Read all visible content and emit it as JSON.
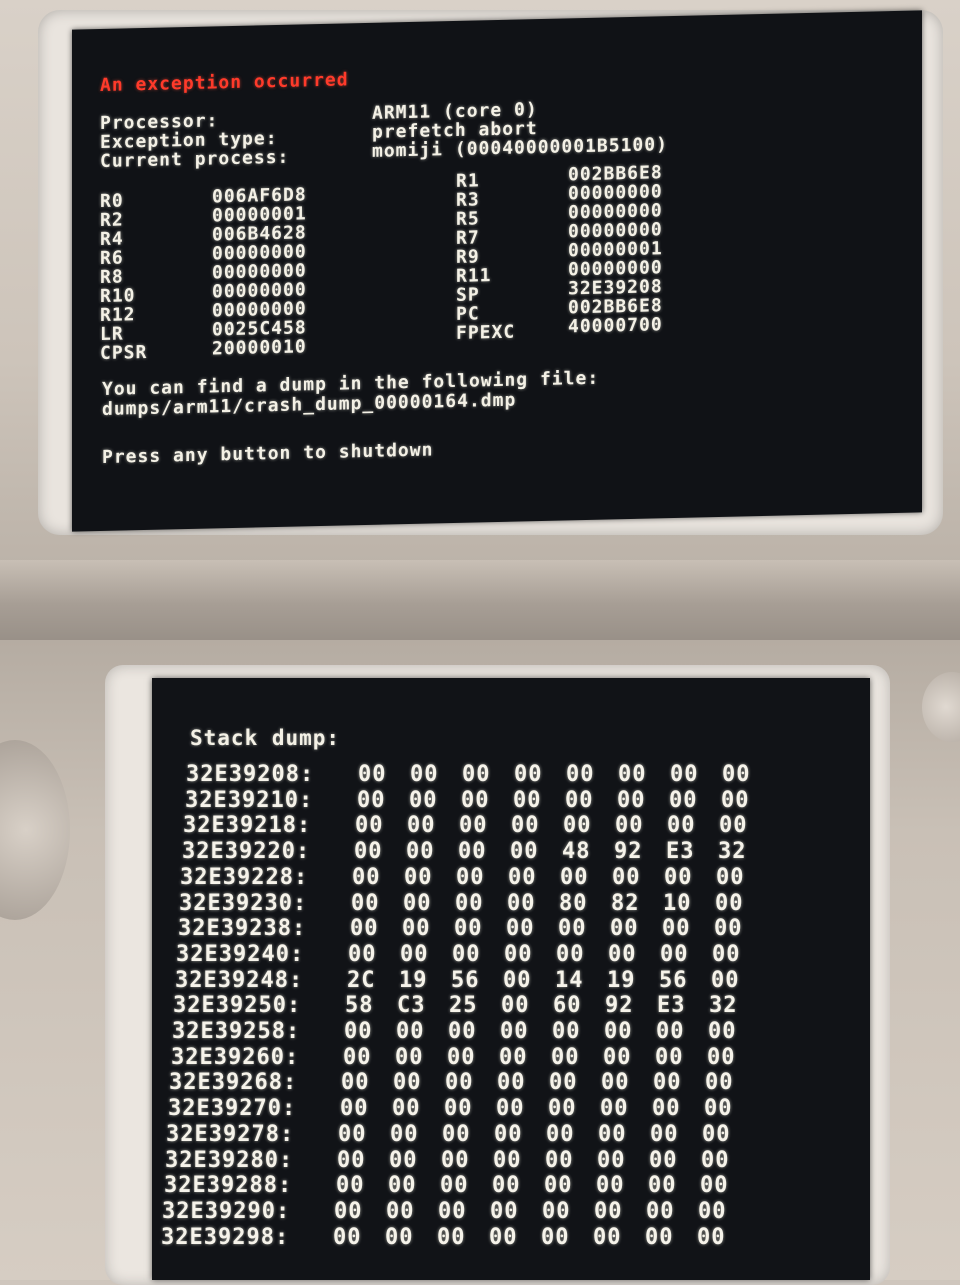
{
  "top_screen": {
    "title": "An exception occurred",
    "info": [
      {
        "label": "Processor:",
        "value": "ARM11 (core 0)"
      },
      {
        "label": "Exception type:",
        "value": "prefetch abort"
      },
      {
        "label": "Current process:",
        "value": "momiji (00040000001B5100)"
      }
    ],
    "registers_left": [
      {
        "name": "R0",
        "value": "006AF6D8"
      },
      {
        "name": "R2",
        "value": "00000001"
      },
      {
        "name": "R4",
        "value": "006B4628"
      },
      {
        "name": "R6",
        "value": "00000000"
      },
      {
        "name": "R8",
        "value": "00000000"
      },
      {
        "name": "R10",
        "value": "00000000"
      },
      {
        "name": "R12",
        "value": "00000000"
      },
      {
        "name": "LR",
        "value": "0025C458"
      },
      {
        "name": "CPSR",
        "value": "20000010"
      }
    ],
    "registers_right": [
      {
        "name": "R1",
        "value": "002BB6E8"
      },
      {
        "name": "R3",
        "value": "00000000"
      },
      {
        "name": "R5",
        "value": "00000000"
      },
      {
        "name": "R7",
        "value": "00000000"
      },
      {
        "name": "R9",
        "value": "00000001"
      },
      {
        "name": "R11",
        "value": "00000000"
      },
      {
        "name": "SP",
        "value": "32E39208"
      },
      {
        "name": "PC",
        "value": "002BB6E8"
      },
      {
        "name": "FPEXC",
        "value": "40000700"
      }
    ],
    "dump_line1": "You can find a dump in the following file:",
    "dump_line2": "dumps/arm11/crash_dump_00000164.dmp",
    "prompt": "Press any button to shutdown"
  },
  "bottom_screen": {
    "title": "Stack dump:",
    "rows": [
      {
        "addr": "32E39208:",
        "bytes": [
          "00",
          "00",
          "00",
          "00",
          "00",
          "00",
          "00",
          "00"
        ]
      },
      {
        "addr": "32E39210:",
        "bytes": [
          "00",
          "00",
          "00",
          "00",
          "00",
          "00",
          "00",
          "00"
        ]
      },
      {
        "addr": "32E39218:",
        "bytes": [
          "00",
          "00",
          "00",
          "00",
          "00",
          "00",
          "00",
          "00"
        ]
      },
      {
        "addr": "32E39220:",
        "bytes": [
          "00",
          "00",
          "00",
          "00",
          "48",
          "92",
          "E3",
          "32"
        ]
      },
      {
        "addr": "32E39228:",
        "bytes": [
          "00",
          "00",
          "00",
          "00",
          "00",
          "00",
          "00",
          "00"
        ]
      },
      {
        "addr": "32E39230:",
        "bytes": [
          "00",
          "00",
          "00",
          "00",
          "80",
          "82",
          "10",
          "00"
        ]
      },
      {
        "addr": "32E39238:",
        "bytes": [
          "00",
          "00",
          "00",
          "00",
          "00",
          "00",
          "00",
          "00"
        ]
      },
      {
        "addr": "32E39240:",
        "bytes": [
          "00",
          "00",
          "00",
          "00",
          "00",
          "00",
          "00",
          "00"
        ]
      },
      {
        "addr": "32E39248:",
        "bytes": [
          "2C",
          "19",
          "56",
          "00",
          "14",
          "19",
          "56",
          "00"
        ]
      },
      {
        "addr": "32E39250:",
        "bytes": [
          "58",
          "C3",
          "25",
          "00",
          "60",
          "92",
          "E3",
          "32"
        ]
      },
      {
        "addr": "32E39258:",
        "bytes": [
          "00",
          "00",
          "00",
          "00",
          "00",
          "00",
          "00",
          "00"
        ]
      },
      {
        "addr": "32E39260:",
        "bytes": [
          "00",
          "00",
          "00",
          "00",
          "00",
          "00",
          "00",
          "00"
        ]
      },
      {
        "addr": "32E39268:",
        "bytes": [
          "00",
          "00",
          "00",
          "00",
          "00",
          "00",
          "00",
          "00"
        ]
      },
      {
        "addr": "32E39270:",
        "bytes": [
          "00",
          "00",
          "00",
          "00",
          "00",
          "00",
          "00",
          "00"
        ]
      },
      {
        "addr": "32E39278:",
        "bytes": [
          "00",
          "00",
          "00",
          "00",
          "00",
          "00",
          "00",
          "00"
        ]
      },
      {
        "addr": "32E39280:",
        "bytes": [
          "00",
          "00",
          "00",
          "00",
          "00",
          "00",
          "00",
          "00"
        ]
      },
      {
        "addr": "32E39288:",
        "bytes": [
          "00",
          "00",
          "00",
          "00",
          "00",
          "00",
          "00",
          "00"
        ]
      },
      {
        "addr": "32E39290:",
        "bytes": [
          "00",
          "00",
          "00",
          "00",
          "00",
          "00",
          "00",
          "00"
        ]
      },
      {
        "addr": "32E39298:",
        "bytes": [
          "00",
          "00",
          "00",
          "00",
          "00",
          "00",
          "00",
          "00"
        ]
      }
    ]
  }
}
